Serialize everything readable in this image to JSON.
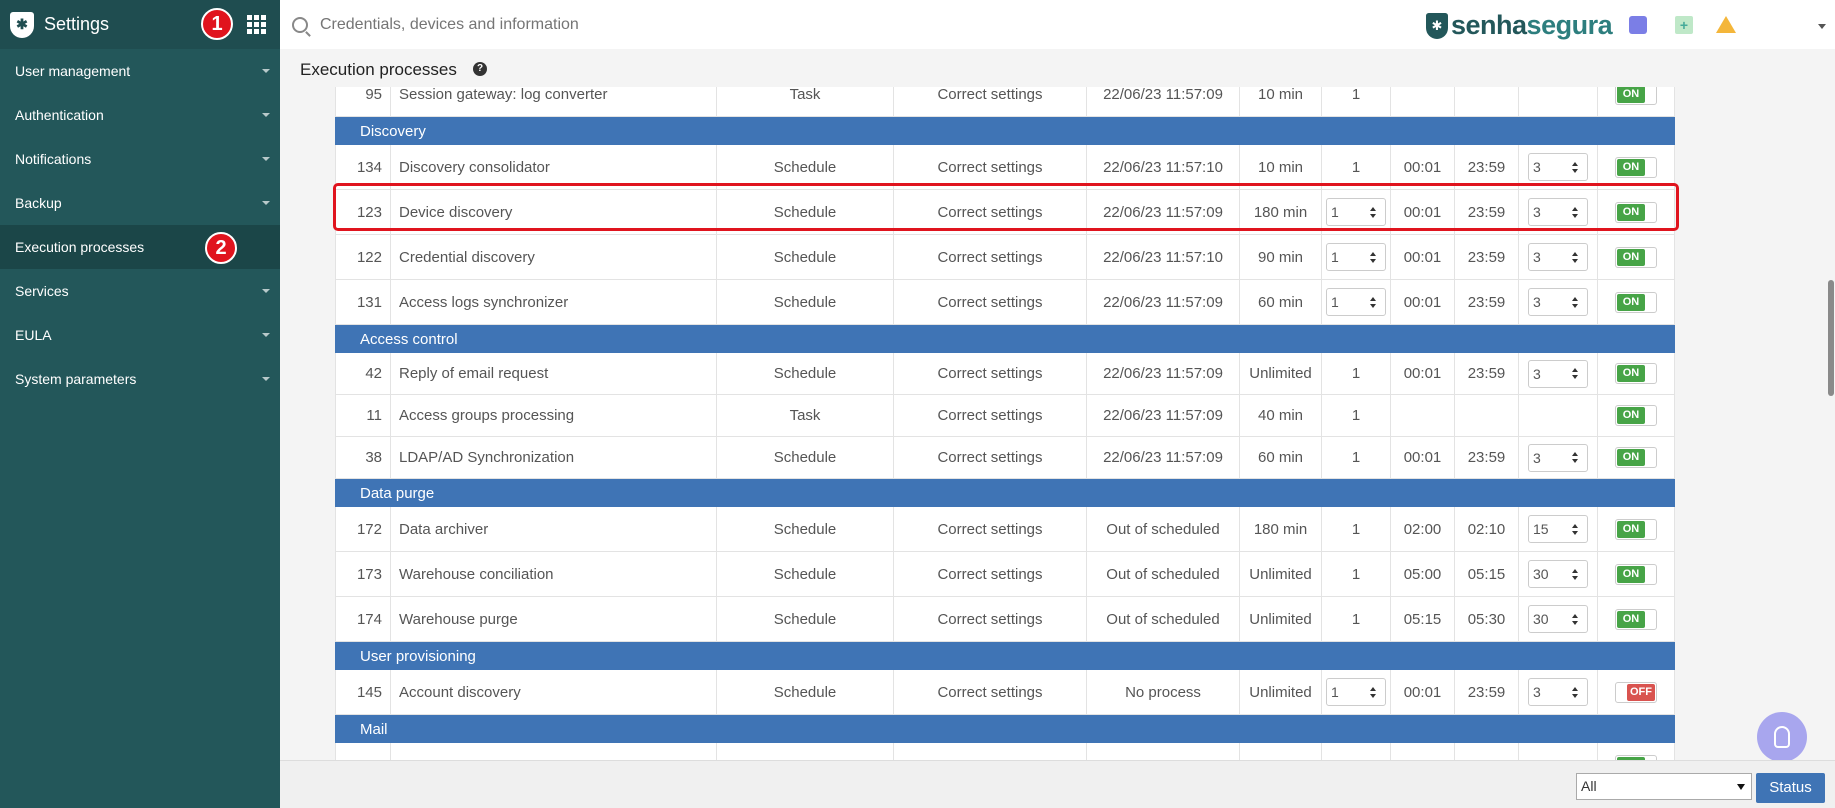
{
  "sidebar": {
    "title": "Settings",
    "badges": [
      "1",
      "2"
    ],
    "items": [
      {
        "label": "User management"
      },
      {
        "label": "Authentication"
      },
      {
        "label": "Notifications"
      },
      {
        "label": "Backup"
      },
      {
        "label": "Execution processes"
      },
      {
        "label": "Services"
      },
      {
        "label": "EULA"
      },
      {
        "label": "System parameters"
      }
    ]
  },
  "search": {
    "placeholder": "Credentials, devices and information"
  },
  "brand": {
    "part1": "senha",
    "part2": "segura"
  },
  "page": {
    "title": "Execution processes",
    "help": "?"
  },
  "table": {
    "rows": [
      {
        "kind": "row",
        "id": "95",
        "name": "Session gateway: log converter",
        "type": "Task",
        "status": "Correct settings",
        "date": "22/06/23 11:57:09",
        "interval": "10 min",
        "instances": "1",
        "start": "",
        "end": "",
        "retry": "",
        "toggle": "ON"
      },
      {
        "kind": "group",
        "label": "Discovery"
      },
      {
        "kind": "row",
        "id": "134",
        "name": "Discovery consolidator",
        "type": "Schedule",
        "status": "Correct settings",
        "date": "22/06/23 11:57:10",
        "interval": "10 min",
        "instances": "1",
        "start": "00:01",
        "end": "23:59",
        "retry": "3",
        "toggle": "ON"
      },
      {
        "kind": "row",
        "id": "123",
        "name": "Device discovery",
        "type": "Schedule",
        "status": "Correct settings",
        "date": "22/06/23 11:57:09",
        "interval": "180 min",
        "instances": "1",
        "instancesSpin": true,
        "start": "00:01",
        "end": "23:59",
        "retry": "3",
        "toggle": "ON"
      },
      {
        "kind": "row",
        "id": "122",
        "name": "Credential discovery",
        "type": "Schedule",
        "status": "Correct settings",
        "date": "22/06/23 11:57:10",
        "interval": "90 min",
        "instances": "1",
        "instancesSpin": true,
        "start": "00:01",
        "end": "23:59",
        "retry": "3",
        "toggle": "ON"
      },
      {
        "kind": "row",
        "id": "131",
        "name": "Access logs synchronizer",
        "type": "Schedule",
        "status": "Correct settings",
        "date": "22/06/23 11:57:09",
        "interval": "60 min",
        "instances": "1",
        "instancesSpin": true,
        "start": "00:01",
        "end": "23:59",
        "retry": "3",
        "toggle": "ON"
      },
      {
        "kind": "group",
        "label": "Access control"
      },
      {
        "kind": "row",
        "id": "42",
        "name": "Reply of email request",
        "type": "Schedule",
        "status": "Correct settings",
        "date": "22/06/23 11:57:09",
        "interval": "Unlimited",
        "instances": "1",
        "start": "00:01",
        "end": "23:59",
        "retry": "3",
        "toggle": "ON",
        "short": true
      },
      {
        "kind": "row",
        "id": "11",
        "name": "Access groups processing",
        "type": "Task",
        "status": "Correct settings",
        "date": "22/06/23 11:57:09",
        "interval": "40 min",
        "instances": "1",
        "start": "",
        "end": "",
        "retry": "",
        "toggle": "ON",
        "short": true
      },
      {
        "kind": "row",
        "id": "38",
        "name": "LDAP/AD Synchronization",
        "type": "Schedule",
        "status": "Correct settings",
        "date": "22/06/23 11:57:09",
        "interval": "60 min",
        "instances": "1",
        "start": "00:01",
        "end": "23:59",
        "retry": "3",
        "toggle": "ON",
        "short": true
      },
      {
        "kind": "group",
        "label": "Data purge"
      },
      {
        "kind": "row",
        "id": "172",
        "name": "Data archiver",
        "type": "Schedule",
        "status": "Correct settings",
        "date": "Out of scheduled",
        "interval": "180 min",
        "instances": "1",
        "start": "02:00",
        "end": "02:10",
        "retry": "15",
        "toggle": "ON"
      },
      {
        "kind": "row",
        "id": "173",
        "name": "Warehouse conciliation",
        "type": "Schedule",
        "status": "Correct settings",
        "date": "Out of scheduled",
        "interval": "Unlimited",
        "instances": "1",
        "start": "05:00",
        "end": "05:15",
        "retry": "30",
        "toggle": "ON"
      },
      {
        "kind": "row",
        "id": "174",
        "name": "Warehouse purge",
        "type": "Schedule",
        "status": "Correct settings",
        "date": "Out of scheduled",
        "interval": "Unlimited",
        "instances": "1",
        "start": "05:15",
        "end": "05:30",
        "retry": "30",
        "toggle": "ON"
      },
      {
        "kind": "group",
        "label": "User provisioning"
      },
      {
        "kind": "row",
        "id": "145",
        "name": "Account discovery",
        "type": "Schedule",
        "status": "Correct settings",
        "date": "No process",
        "interval": "Unlimited",
        "instances": "1",
        "instancesSpin": true,
        "start": "00:01",
        "end": "23:59",
        "retry": "3",
        "toggle": "OFF"
      },
      {
        "kind": "group",
        "label": "Mail"
      },
      {
        "kind": "row",
        "id": "",
        "name": "",
        "type": "",
        "status": "",
        "date": "",
        "interval": "",
        "instances": "",
        "start": "",
        "end": "",
        "retry": "",
        "toggle": "ON"
      }
    ]
  },
  "footer": {
    "filter_value": "All",
    "status_label": "Status"
  },
  "colors": {
    "sidebar": "#23575a",
    "group_header": "#3f74b5",
    "toggle_on": "#47a447",
    "toggle_off": "#d9534f",
    "highlight": "#e0141e"
  },
  "icons": [
    "search-icon",
    "apps-grid-icon",
    "home-icon",
    "add-file-icon",
    "warning-icon",
    "help-icon",
    "lightbulb-icon"
  ]
}
